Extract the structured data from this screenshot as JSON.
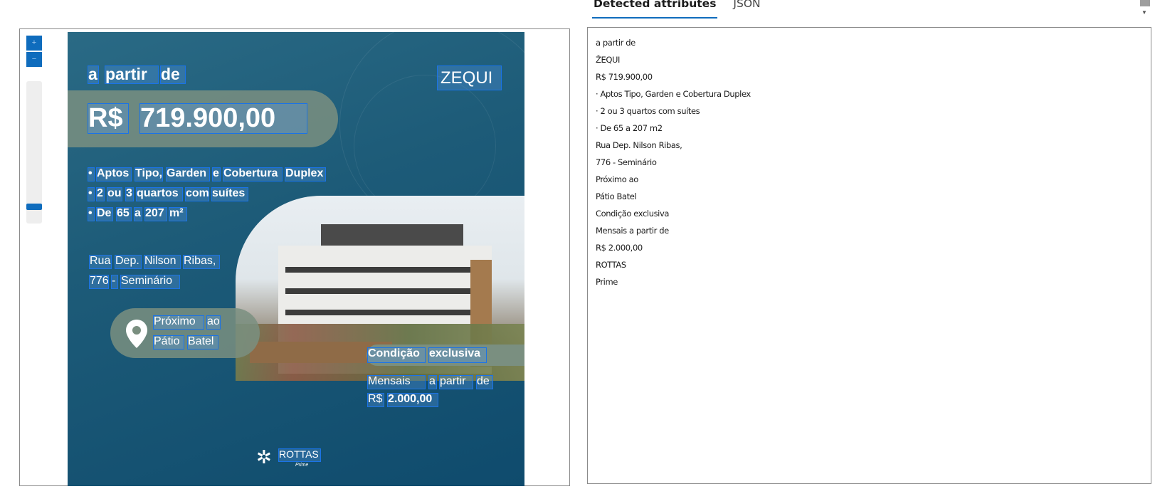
{
  "tabs": [
    {
      "label": "Detected attributes",
      "active": true
    },
    {
      "label": "JSON",
      "active": false
    }
  ],
  "viewer": {
    "zoom_in_label": "+",
    "zoom_out_label": "−",
    "zoom_level": 0.1
  },
  "image_text": {
    "a_partir": [
      "a",
      "partir",
      "de"
    ],
    "price_currency": "R$",
    "price_value": "719.900,00",
    "brand_logo": "ZEQUI",
    "bullet1": [
      "•",
      "Aptos",
      "Tipo,",
      "Garden",
      "e",
      "Cobertura",
      "Duplex"
    ],
    "bullet2": [
      "•",
      "2",
      "ou",
      "3",
      "quartos",
      "com",
      "suítes"
    ],
    "bullet3": [
      "•",
      "De",
      "65",
      "a",
      "207",
      "m²"
    ],
    "address1": [
      "Rua",
      "Dep.",
      "Nilson",
      "Ribas,"
    ],
    "address2": [
      "776",
      "-",
      "Seminário"
    ],
    "near1": [
      "Próximo",
      "ao"
    ],
    "near2": [
      "Pátio",
      "Batel"
    ],
    "exclusive": [
      "Condição",
      "exclusiva"
    ],
    "monthly1": [
      "Mensais",
      "a",
      "partir",
      "de"
    ],
    "monthly2": [
      "R$",
      "2.000,00"
    ],
    "footer_logo": "ROTTAS",
    "footer_logo_sub": "Prime"
  },
  "detected_attributes": [
    "a partir de",
    "ŽEQUI",
    "R$ 719.900,00",
    "· Aptos Tipo, Garden e Cobertura Duplex",
    "· 2 ou 3 quartos com suítes",
    "· De 65 a 207 m2",
    "Rua Dep. Nilson Ribas,",
    "776 - Seminário",
    "Próximo ao",
    "Pátio Batel",
    "Condição exclusiva",
    "Mensais a partir de",
    "R$ 2.000,00",
    "ROTTAS",
    "Prime"
  ],
  "colors": {
    "accent": "#0f6cbd",
    "highlight_border": "#1a73e8",
    "ad_background": "#1d5b78"
  }
}
